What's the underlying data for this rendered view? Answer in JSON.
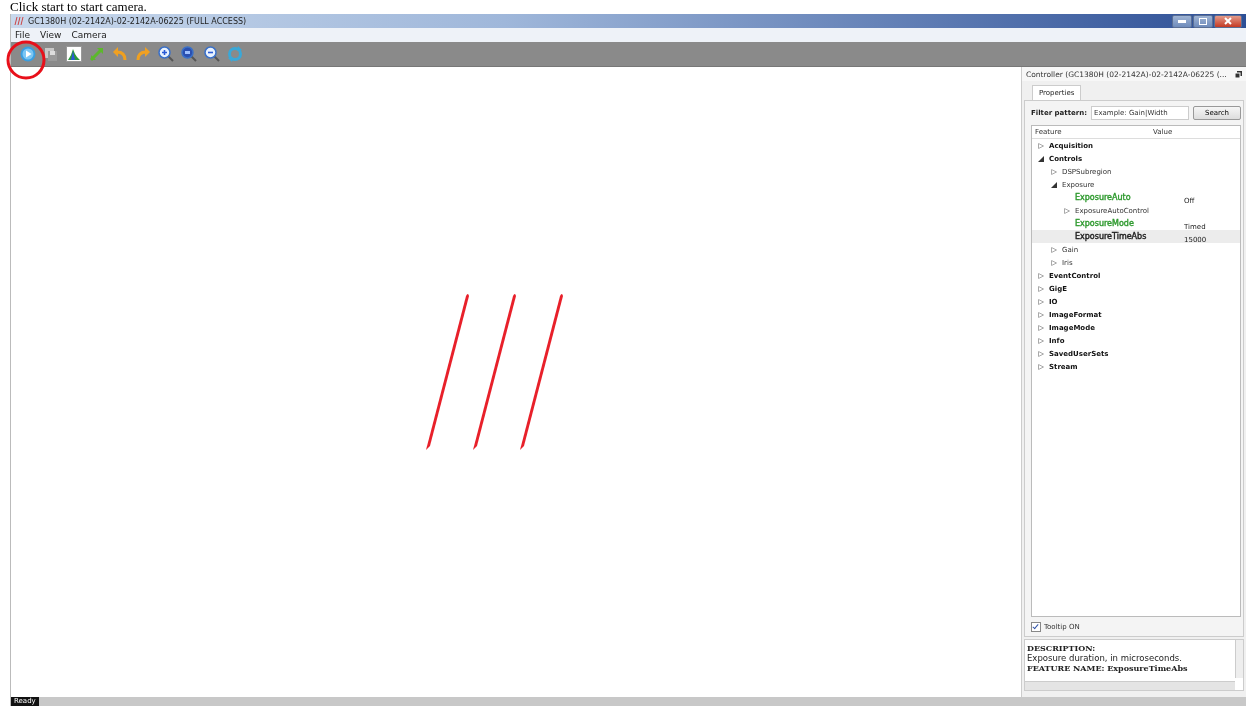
{
  "caption": "Click start to start camera.",
  "window": {
    "title": "GC1380H (02-2142A)-02-2142A-06225 (FULL ACCESS)"
  },
  "menu": [
    "File",
    "View",
    "Camera"
  ],
  "toolbar": [
    {
      "kind": "play"
    },
    {
      "kind": "save"
    },
    {
      "kind": "histogram"
    },
    {
      "kind": "fit"
    },
    {
      "kind": "undo"
    },
    {
      "kind": "redo"
    },
    {
      "kind": "zoomin"
    },
    {
      "kind": "zoom"
    },
    {
      "kind": "zoomout"
    },
    {
      "kind": "refresh"
    }
  ],
  "controller": {
    "title": "Controller  (GC1380H (02-2142A)-02-2142A-06225 (...",
    "tabs": [
      {
        "label": "Properties",
        "selected": true
      }
    ],
    "filter": {
      "label": "Filter pattern:",
      "placeholder": "Example: Gain|Width",
      "button": "Search"
    },
    "tree": {
      "columns": [
        "Feature",
        "Value"
      ],
      "items": [
        {
          "kind": "category",
          "name": "Acquisition",
          "expanded": false,
          "selected": false
        },
        {
          "kind": "category",
          "name": "Controls",
          "expanded": true,
          "selected": false,
          "children": [
            {
              "kind": "category",
              "name": "DSPSubregion",
              "expanded": false,
              "selected": false
            },
            {
              "kind": "category",
              "name": "Exposure",
              "expanded": true,
              "selected": false,
              "children": [
                {
                  "kind": "feature",
                  "name": "ExposureAuto",
                  "value": "Off",
                  "color": "#2f9a2f",
                  "selected": false
                },
                {
                  "kind": "category",
                  "name": "ExposureAutoControl",
                  "expanded": false,
                  "selected": false
                },
                {
                  "kind": "feature",
                  "name": "ExposureMode",
                  "value": "Timed",
                  "color": "#2f9a2f",
                  "selected": false
                },
                {
                  "kind": "feature",
                  "name": "ExposureTimeAbs",
                  "value": "15000",
                  "color": "#222222",
                  "selected": true
                }
              ]
            },
            {
              "kind": "category",
              "name": "Gain",
              "expanded": false,
              "selected": false
            },
            {
              "kind": "category",
              "name": "Iris",
              "expanded": false,
              "selected": false
            }
          ]
        },
        {
          "kind": "category",
          "name": "EventControl",
          "expanded": false,
          "selected": false
        },
        {
          "kind": "category",
          "name": "GigE",
          "expanded": false,
          "selected": false
        },
        {
          "kind": "category",
          "name": "IO",
          "expanded": false,
          "selected": false
        },
        {
          "kind": "category",
          "name": "ImageFormat",
          "expanded": false,
          "selected": false
        },
        {
          "kind": "category",
          "name": "ImageMode",
          "expanded": false,
          "selected": false
        },
        {
          "kind": "category",
          "name": "Info",
          "expanded": false,
          "selected": false
        },
        {
          "kind": "category",
          "name": "SavedUserSets",
          "expanded": false,
          "selected": false
        },
        {
          "kind": "category",
          "name": "Stream",
          "expanded": false,
          "selected": false
        }
      ]
    },
    "tooltip": {
      "label": "Tooltip ON",
      "checked": true
    },
    "description": {
      "heading": "DESCRIPTION:",
      "text": "Exposure duration, in microseconds.",
      "feature_name": "FEATURE NAME: ExposureTimeAbs"
    }
  },
  "status_bar": {
    "text": "Ready"
  }
}
